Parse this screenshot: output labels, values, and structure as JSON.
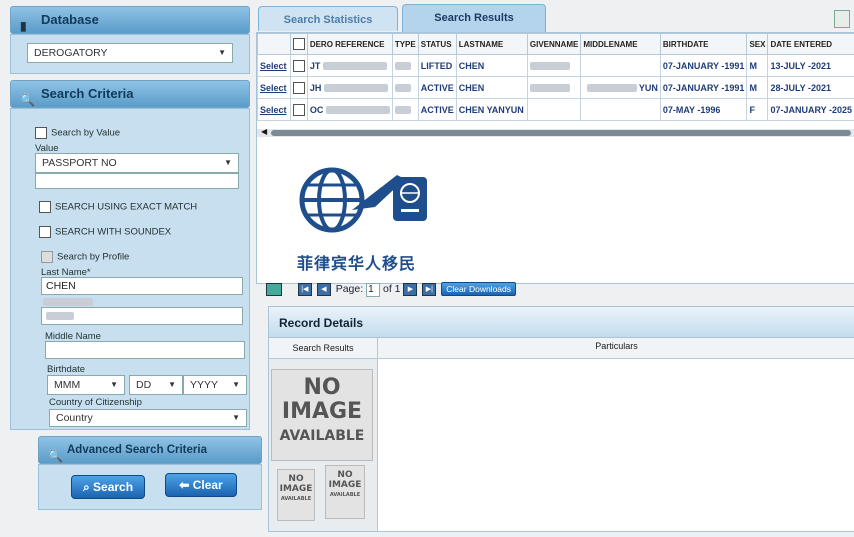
{
  "sidebar": {
    "database_title": "Database",
    "database_value": "DEROGATORY",
    "criteria_title": "Search Criteria",
    "search_by_value": "Search by Value",
    "value_label": "Value",
    "value_select": "PASSPORT NO",
    "exact_match": "SEARCH USING EXACT MATCH",
    "soundex": "SEARCH WITH SOUNDEX",
    "by_profile": "Search by Profile",
    "last_name_label": "Last Name*",
    "last_name_value": "CHEN",
    "middle_name_label": "Middle Name",
    "birthdate_label": "Birthdate",
    "mmm": "MMM",
    "dd": "DD",
    "yyyy": "YYYY",
    "citizenship_label": "Country of Citizenship",
    "country": "Country",
    "advanced_title": "Advanced Search Criteria",
    "search_btn": "Search",
    "clear_btn": "Clear"
  },
  "tabs": {
    "stats": "Search Statistics",
    "results": "Search Results"
  },
  "results": {
    "headers": [
      "",
      "DERO REFERENCE",
      "TYPE",
      "STATUS",
      "LASTNAME",
      "GIVENNAME",
      "MIDDLENAME",
      "BIRTHDATE",
      "SEX",
      "DATE ENTERED"
    ],
    "select_label": "Select",
    "rows": [
      {
        "ref": "JT",
        "status": "LIFTED",
        "last": "CHEN",
        "given": "",
        "middle": "",
        "birth": "07-JANUARY -1991",
        "sex": "M",
        "entered": "13-JULY -2021"
      },
      {
        "ref": "JH",
        "status": "ACTIVE",
        "last": "CHEN",
        "given": "",
        "middle": "YUN",
        "birth": "07-JANUARY -1991",
        "sex": "M",
        "entered": "28-JULY -2021"
      },
      {
        "ref": "OC",
        "status": "ACTIVE",
        "last": "CHEN YANYUN",
        "given": "",
        "middle": "",
        "birth": "07-MAY -1996",
        "sex": "F",
        "entered": "07-JANUARY -2025"
      }
    ]
  },
  "watermark": "菲律宾华人移民",
  "pager": {
    "page_label": "Page:",
    "page": "1",
    "of_label": "of",
    "total": "1",
    "clear_downloads": "Clear Downloads"
  },
  "record": {
    "title": "Record Details",
    "col_search": "Search Results",
    "col_particulars": "Particulars",
    "no_image": [
      "NO",
      "IMAGE",
      "AVAILABLE"
    ]
  }
}
